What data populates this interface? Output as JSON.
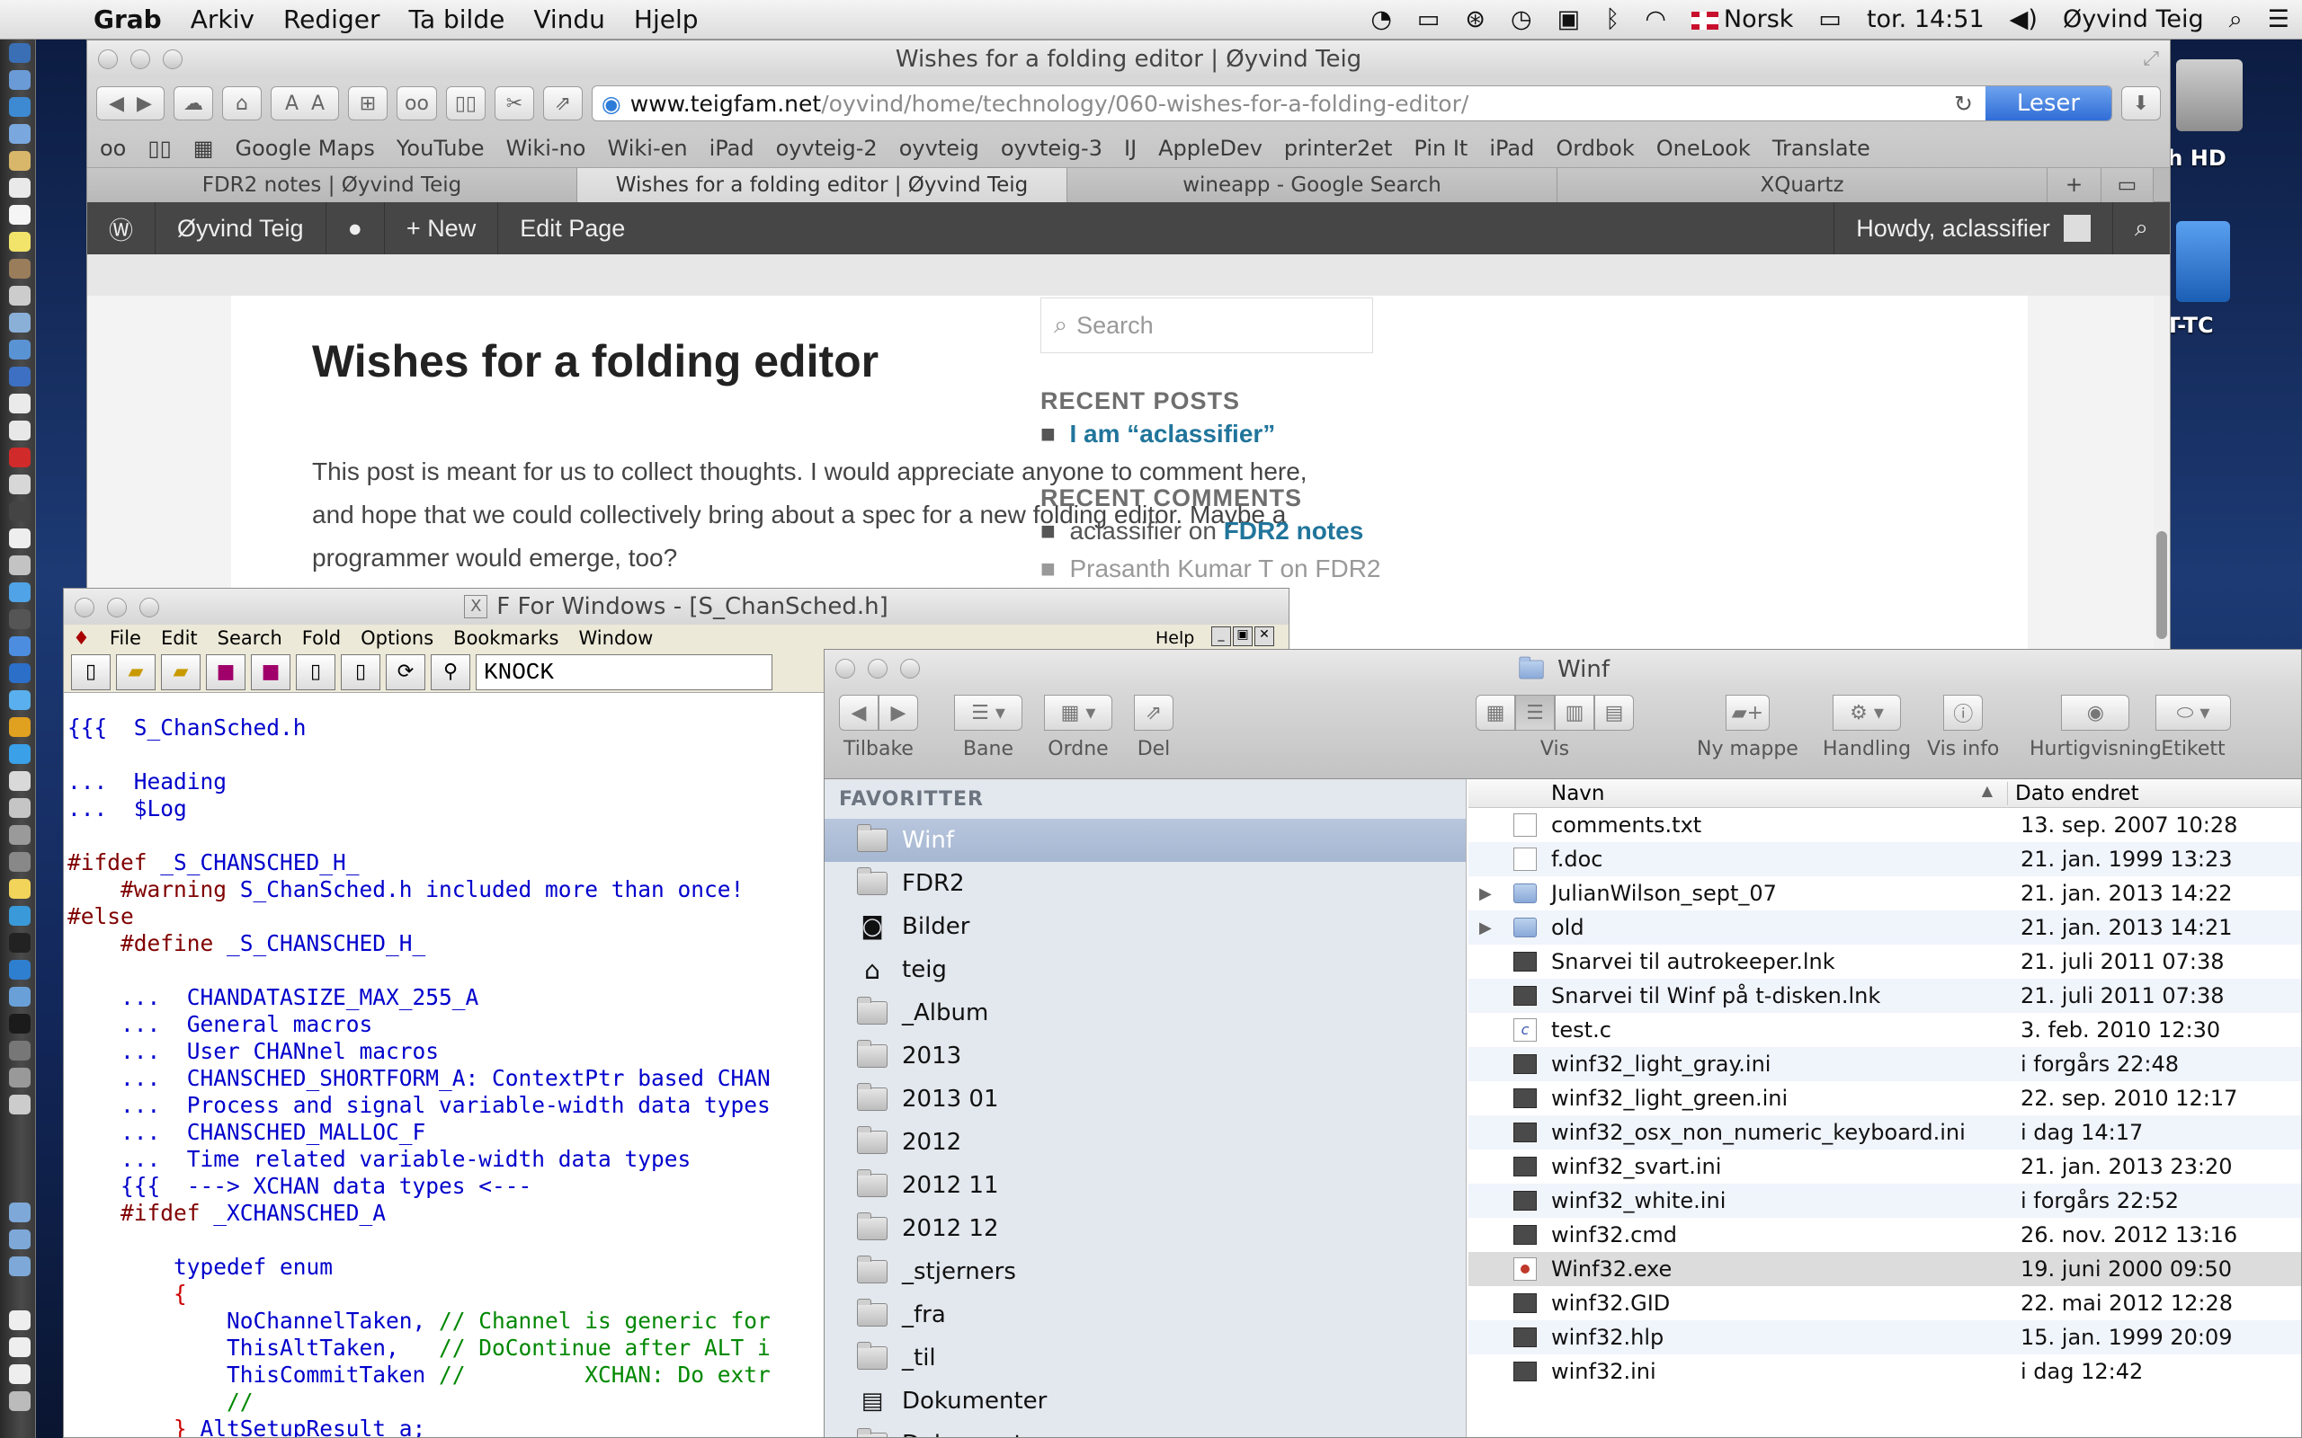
{
  "menubar": {
    "app": "Grab",
    "items": [
      "Arkiv",
      "Rediger",
      "Ta bilde",
      "Vindu",
      "Hjelp"
    ],
    "language": "Norsk",
    "clock": "tor. 14:51",
    "user": "Øyvind Teig"
  },
  "desktop": {
    "disk_label": "sh HD",
    "bt_label": "BT-TC"
  },
  "safari": {
    "title": "Wishes for a folding editor | Øyvind Teig",
    "url_domain": "www.teigfam.net",
    "url_path": "/oyvind/home/technology/060-wishes-for-a-folding-editor/",
    "reader_label": "Leser",
    "bookmarks": [
      "Google Maps",
      "YouTube",
      "Wiki-no",
      "Wiki-en",
      "iPad",
      "oyvteig-2",
      "oyvteig",
      "oyvteig-3",
      "IJ",
      "AppleDev",
      "printer2et",
      "Pin It",
      "iPad",
      "Ordbok",
      "OneLook",
      "Translate"
    ],
    "tabs": [
      "FDR2 notes | Øyvind Teig",
      "Wishes for a folding editor | Øyvind Teig",
      "wineapp - Google Search",
      "XQuartz"
    ],
    "tab_add": "+",
    "wpbar": {
      "site": "Øyvind Teig",
      "new": "New",
      "edit": "Edit Page",
      "howdy": "Howdy, aclassifier"
    },
    "post": {
      "title": "Wishes for a folding editor",
      "body": "This post is meant for us to collect thoughts. I would appreciate anyone to comment here, and hope that we could collectively bring about a spec for a new folding editor. Maybe a programmer would emerge, too?"
    },
    "sidebar": {
      "search_placeholder": "Search",
      "recent_posts_heading": "RECENT POSTS",
      "recent_post": "I am “aclassifier”",
      "recent_comments_heading": "RECENT COMMENTS",
      "comment_author": "aclassifier",
      "comment_on": "on",
      "comment_post": "FDR2 notes",
      "comment2": "Prasanth Kumar T on FDR2"
    }
  },
  "fwin": {
    "title": "F For Windows - [S_ChanSched.h]",
    "menu": [
      "File",
      "Edit",
      "Search",
      "Fold",
      "Options",
      "Bookmarks",
      "Window"
    ],
    "help": "Help",
    "search_value": "KNOCK",
    "code": [
      "{{{  S_ChanSched.h",
      "",
      "...  Heading",
      "...  $Log",
      "",
      "#ifdef _S_CHANSCHED_H_",
      "    #warning S_ChanSched.h included more than once!",
      "#else",
      "    #define _S_CHANSCHED_H_",
      "",
      "    ...  CHANDATASIZE_MAX_255_A",
      "    ...  General macros",
      "    ...  User CHANnel macros",
      "    ...  CHANSCHED_SHORTFORM_A: ContextPtr based CHAN",
      "    ...  Process and signal variable-width data types",
      "    ...  CHANSCHED_MALLOC_F",
      "    ...  Time related variable-width data types",
      "    {{{  ---> XCHAN data types <---",
      "    #ifdef _XCHANSCHED_A",
      "",
      "        typedef enum",
      "        {",
      "            NoChannelTaken, // Channel is generic for",
      "            ThisAltTaken,   // DoContinue after ALT i",
      "            ThisCommitTaken //         XCHAN: Do extr",
      "            //",
      "        } AltSetupResult_a;"
    ]
  },
  "finder": {
    "title": "Winf",
    "toolbar": {
      "back": "Tilbake",
      "path": "Bane",
      "arrange": "Ordne",
      "share": "Del",
      "view": "Vis",
      "new_folder": "Ny mappe",
      "action": "Handling",
      "info": "Vis info",
      "quicklook": "Hurtigvisning",
      "label": "Etikett"
    },
    "favorites_heading": "FAVORITTER",
    "sidebar": [
      "Winf",
      "FDR2",
      "Bilder",
      "teig",
      "_Album",
      "2013",
      "2013 01",
      "2012",
      "2012 11",
      "2012 12",
      "_stjerners",
      "_fra",
      "_til",
      "Dokumenter",
      "Dokumenter"
    ],
    "col_name": "Navn",
    "col_date": "Dato endret",
    "files": [
      {
        "name": "comments.txt",
        "date": "13. sep. 2007 10:28",
        "icon": "doc"
      },
      {
        "name": "f.doc",
        "date": "21. jan. 1999 13:23",
        "icon": "doc"
      },
      {
        "name": "JulianWilson_sept_07",
        "date": "21. jan. 2013 14:22",
        "icon": "folder"
      },
      {
        "name": "old",
        "date": "21. jan. 2013 14:21",
        "icon": "folder"
      },
      {
        "name": "Snarvei til autrokeeper.lnk",
        "date": "21. juli 2011 07:38",
        "icon": "blk"
      },
      {
        "name": "Snarvei til Winf på t-disken.lnk",
        "date": "21. juli 2011 07:38",
        "icon": "blk"
      },
      {
        "name": "test.c",
        "date": "3. feb. 2010 12:30",
        "icon": "c"
      },
      {
        "name": "winf32_light_gray.ini",
        "date": "i forgårs 22:48",
        "icon": "blk"
      },
      {
        "name": "winf32_light_green.ini",
        "date": "22. sep. 2010 12:17",
        "icon": "blk"
      },
      {
        "name": "winf32_osx_non_numeric_keyboard.ini",
        "date": "i dag 14:17",
        "icon": "blk"
      },
      {
        "name": "winf32_svart.ini",
        "date": "21. jan. 2013 23:20",
        "icon": "blk"
      },
      {
        "name": "winf32_white.ini",
        "date": "i forgårs 22:52",
        "icon": "blk"
      },
      {
        "name": "winf32.cmd",
        "date": "26. nov. 2012 13:16",
        "icon": "blk"
      },
      {
        "name": "Winf32.exe",
        "date": "19. juni 2000 09:50",
        "icon": "exe"
      },
      {
        "name": "winf32.GID",
        "date": "22. mai 2012 12:28",
        "icon": "blk"
      },
      {
        "name": "winf32.hlp",
        "date": "15. jan. 1999 20:09",
        "icon": "blk"
      },
      {
        "name": "winf32.ini",
        "date": "i dag 12:42",
        "icon": "blk"
      }
    ]
  }
}
